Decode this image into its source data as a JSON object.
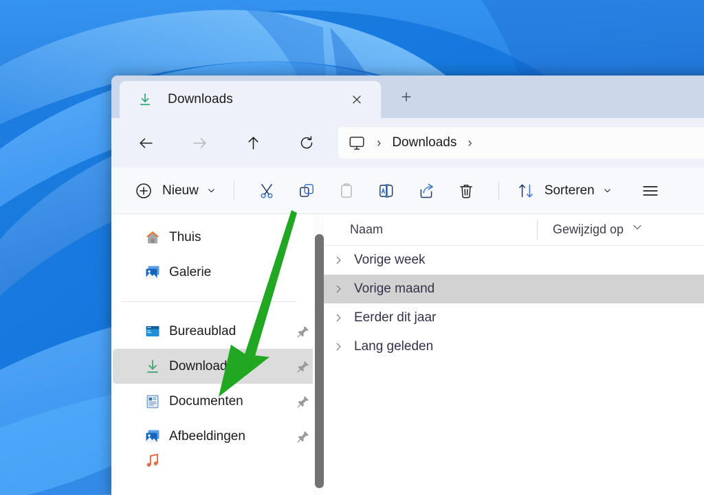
{
  "window": {
    "tab": {
      "title": "Downloads",
      "icon": "downloads-arrow-icon",
      "close_label": "×",
      "newtab_label": "+"
    },
    "navigation": {
      "back": "back-arrow-icon",
      "forward": "forward-arrow-icon",
      "up": "up-arrow-icon",
      "refresh": "refresh-icon"
    },
    "address": {
      "root_icon": "monitor-icon",
      "separator": "›",
      "crumb": "Downloads",
      "trailing_separator": "›"
    },
    "toolbar": {
      "new_label": "Nieuw",
      "new_icon": "plus-circle-icon",
      "cut_icon": "scissors-icon",
      "copy_icon": "copy-icon",
      "paste_icon": "paste-icon",
      "rename_icon": "rename-icon",
      "share_icon": "share-icon",
      "delete_icon": "trash-icon",
      "sort_label": "Sorteren",
      "sort_icon": "sort-arrows-icon",
      "menu_icon": "hamburger-menu-icon",
      "chevron": "chevron-down-icon"
    }
  },
  "sidebar": {
    "top_items": [
      {
        "label": "Thuis",
        "icon": "home-icon",
        "pinned": false,
        "selected": false
      },
      {
        "label": "Galerie",
        "icon": "gallery-icon",
        "pinned": false,
        "selected": false
      }
    ],
    "pinned_items": [
      {
        "label": "Bureaublad",
        "icon": "desktop-icon",
        "pinned": true,
        "selected": false
      },
      {
        "label": "Downloads",
        "icon": "downloads-arrow-icon",
        "pinned": true,
        "selected": true
      },
      {
        "label": "Documenten",
        "icon": "documents-icon",
        "pinned": true,
        "selected": false
      },
      {
        "label": "Afbeeldingen",
        "icon": "pictures-icon",
        "pinned": true,
        "selected": false
      }
    ]
  },
  "list": {
    "columns": [
      {
        "key": "name",
        "label": "Naam"
      },
      {
        "key": "modified",
        "label": "Gewijzigd op"
      }
    ],
    "groups": [
      {
        "label": "Vorige week",
        "expanded": false,
        "selected": false
      },
      {
        "label": "Vorige maand",
        "expanded": false,
        "selected": true
      },
      {
        "label": "Eerder dit jaar",
        "expanded": false,
        "selected": false
      },
      {
        "label": "Lang geleden",
        "expanded": false,
        "selected": false
      }
    ]
  },
  "annotation": {
    "type": "arrow",
    "color": "#21a721",
    "points_to": "sidebar-item-downloads"
  },
  "colors": {
    "desktop": "#1478d8",
    "titlebar": "#ccd7ea",
    "tab_active": "#eef2f8",
    "selection": "#dcdcdc",
    "accent": "#0f6cbd",
    "annotation_green": "#21a721"
  }
}
